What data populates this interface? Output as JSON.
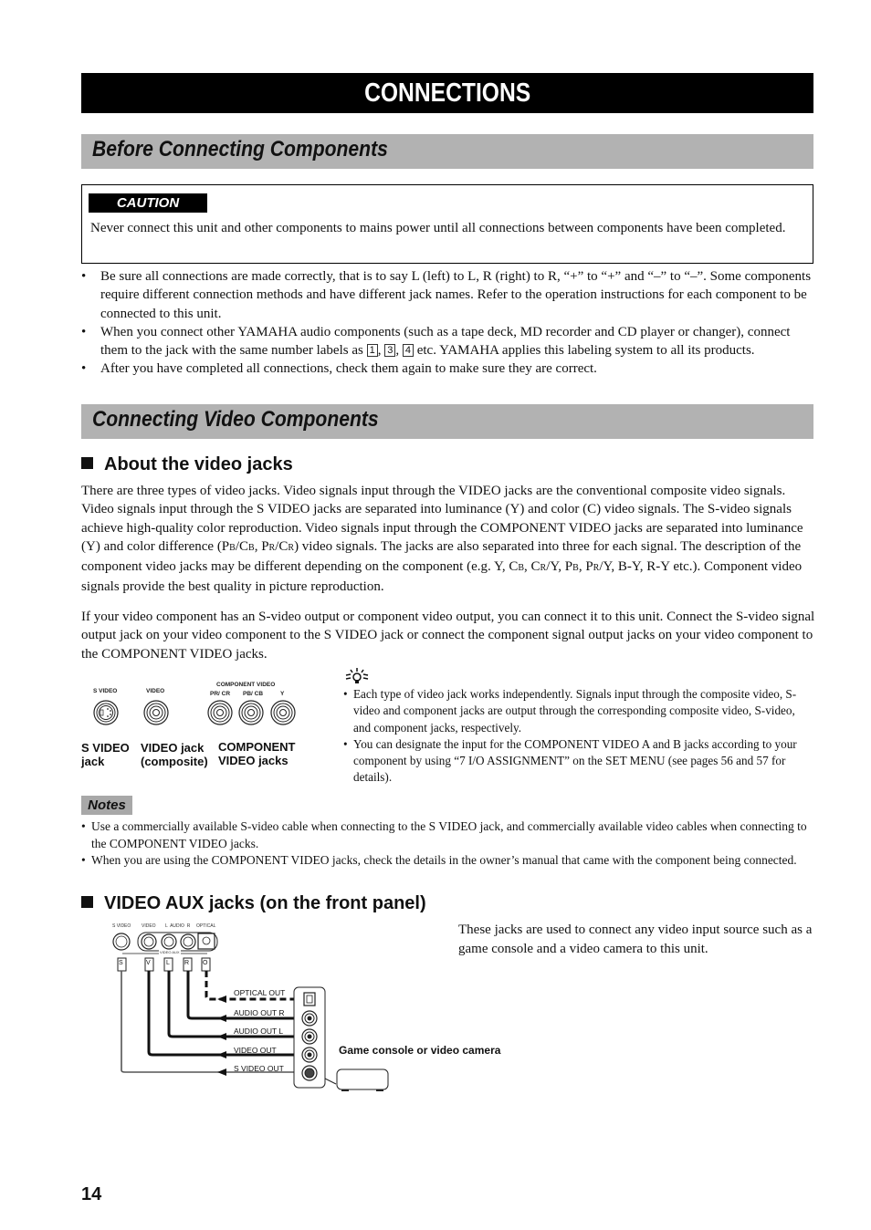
{
  "page": {
    "title": "CONNECTIONS",
    "page_number": "14"
  },
  "before_connecting": {
    "heading": "Before Connecting Components",
    "caution": {
      "label": "CAUTION",
      "text": "Never connect this unit and other components to mains power until all connections between components have been completed."
    },
    "bullets": [
      {
        "text": "Be sure all connections are made correctly, that is to say L (left) to L, R (right) to R, “+” to “+” and “–” to “–”. Some components require different connection methods and have different jack names. Refer to the operation instructions for each component to be connected to this unit."
      },
      {
        "text_before": "When you connect other YAMAHA audio components (such as a tape deck, MD recorder and CD player or changer), connect them to the jack with the same number labels as ",
        "number_labels": [
          "1",
          "3",
          "4"
        ],
        "text_after": " etc. YAMAHA applies this labeling system to all its products."
      },
      {
        "text": "After you have completed all connections, check them again to make sure they are correct."
      }
    ]
  },
  "connecting_video": {
    "heading": "Connecting Video Components",
    "about": {
      "subheading": "About the video jacks",
      "paragraph1_html_parts": [
        "There are three types of video jacks. Video signals input through the VIDEO jacks are the conventional composite video signals. Video signals input through the S VIDEO jacks are separated into luminance (Y) and color (C) video signals. The S-video signals achieve high-quality color reproduction. Video signals input through the COMPONENT VIDEO jacks are separated into luminance (Y) and color difference (P",
        "B",
        "/C",
        "B",
        ", P",
        "R",
        "/C",
        "R",
        ") video signals. The jacks are also separated into three for each signal. The description of the component video jacks may be different depending on the component (e.g. Y, C",
        "B",
        ", C",
        "R",
        "/Y, P",
        "B",
        ", P",
        "R",
        "/Y, B-Y, R-Y etc.). Component video signals provide the best quality in picture reproduction."
      ],
      "paragraph2": "If your video component has an S-video output or component video output, you can connect it to this unit. Connect the S-video signal output jack on your video component to the S VIDEO jack or connect the component signal output jacks on your video component to the COMPONENT VIDEO jacks."
    },
    "jack_diagram": {
      "top_labels": {
        "s_video": "S VIDEO",
        "video": "VIDEO",
        "component_video": "COMPONENT VIDEO",
        "pr_cr": "PR/ CR",
        "pb_cb": "PB/ CB",
        "y": "Y"
      },
      "captions": {
        "s_video_line1": "S VIDEO",
        "s_video_line2": "jack",
        "video_line1": "VIDEO jack",
        "video_line2": "(composite)",
        "component_line1": "COMPONENT",
        "component_line2": "VIDEO jacks"
      }
    },
    "tips": {
      "icon": "lightbulb-tip-icon",
      "items": [
        "Each type of video jack works independently. Signals input through the composite video, S-video and component jacks are output through the corresponding composite video, S-video, and component jacks, respectively.",
        "You can designate the input for the COMPONENT VIDEO A and B jacks according to your component by using “7 I/O ASSIGNMENT” on the SET MENU (see pages 56 and 57 for details)."
      ]
    },
    "notes": {
      "label": "Notes",
      "items": [
        "Use a commercially available S-video cable when connecting to the S VIDEO jack, and commercially available video cables when connecting to the COMPONENT VIDEO jacks.",
        "When you are using the COMPONENT VIDEO jacks, check the details in the owner’s manual that came with the component being connected."
      ]
    },
    "video_aux": {
      "subheading": "VIDEO AUX jacks (on the front panel)",
      "description": "These jacks are used to connect any video input source such as a game console and a video camera to this unit.",
      "panel_labels": {
        "s_video": "S VIDEO",
        "video": "VIDEO",
        "audio": "L  AUDIO  R",
        "optical": "OPTICAL",
        "group": "VIDEO AUX"
      },
      "plug_letters": [
        "S",
        "V",
        "L",
        "R",
        "O"
      ],
      "outputs": [
        "OPTICAL OUT",
        "AUDIO OUT R",
        "AUDIO OUT L",
        "VIDEO OUT",
        "S VIDEO OUT"
      ],
      "device_label": "Game console or video camera"
    }
  }
}
